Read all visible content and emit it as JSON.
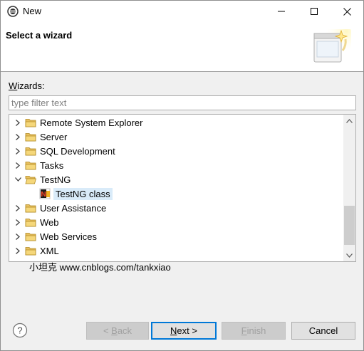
{
  "window": {
    "title": "New",
    "controls": {
      "minimize": "minimize",
      "maximize": "maximize",
      "close": "close"
    }
  },
  "banner": {
    "title": "Select a wizard"
  },
  "wizards": {
    "label_prefix": "W",
    "label_rest": "izards:",
    "filter_placeholder": "type filter text"
  },
  "tree": {
    "items": [
      {
        "label": "Remote System Explorer",
        "expanded": false
      },
      {
        "label": "Server",
        "expanded": false
      },
      {
        "label": "SQL Development",
        "expanded": false
      },
      {
        "label": "Tasks",
        "expanded": false
      },
      {
        "label": "TestNG",
        "expanded": true
      },
      {
        "label": "TestNG class",
        "child": true,
        "selected": true
      },
      {
        "label": "User Assistance",
        "expanded": false
      },
      {
        "label": "Web",
        "expanded": false
      },
      {
        "label": "Web Services",
        "expanded": false
      },
      {
        "label": "XML",
        "expanded": false
      }
    ]
  },
  "watermark": "小坦克 www.cnblogs.com/tankxiao",
  "buttons": {
    "back_prefix": "< ",
    "back_mnemonic": "B",
    "back_rest": "ack",
    "next_mnemonic": "N",
    "next_rest": "ext >",
    "finish_mnemonic": "F",
    "finish_rest": "inish",
    "cancel": "Cancel"
  },
  "colors": {
    "selection": "#d9ebf9",
    "folder": "#e8c060",
    "default_button_border": "#0078d7"
  }
}
